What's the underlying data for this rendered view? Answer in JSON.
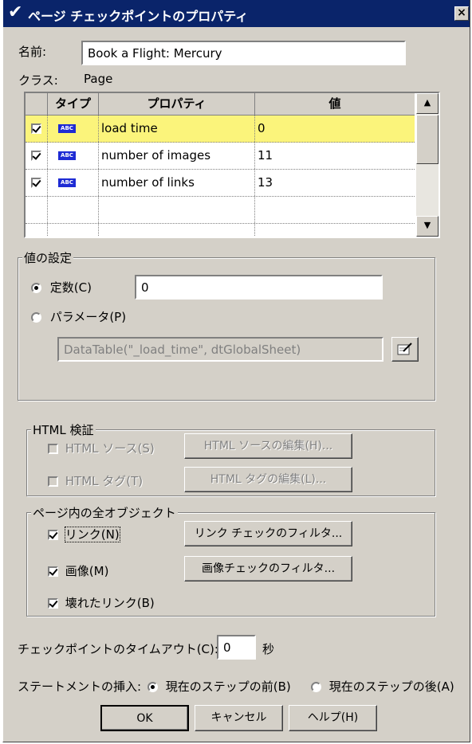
{
  "window": {
    "title": "ページ チェックポイントのプロパティ",
    "close": "×"
  },
  "name_label": "名前:",
  "name_value": "Book a Flight: Mercury",
  "class_label": "クラス:",
  "class_value": "Page",
  "table": {
    "headers": [
      "タイプ",
      "プロパティ",
      "値"
    ],
    "type_icon": "ABC",
    "rows": [
      {
        "checked": true,
        "property": "load time",
        "value": "0"
      },
      {
        "checked": true,
        "property": "number of images",
        "value": "11"
      },
      {
        "checked": true,
        "property": "number of links",
        "value": "13"
      }
    ]
  },
  "value_settings": {
    "label": "値の設定",
    "constant_label": "定数(C)",
    "constant_value": "0",
    "parameter_label": "パラメータ(P)",
    "parameter_value": "DataTable(\"_load_time\", dtGlobalSheet)"
  },
  "html_verify": {
    "label": "HTML 検証",
    "html_source": "HTML ソース(S)",
    "html_source_edit": "HTML ソースの編集(H)...",
    "html_tag": "HTML タグ(T)",
    "html_tag_edit": "HTML タグの編集(L)..."
  },
  "all_objects": {
    "label": "ページ内の全オブジェクト",
    "links": "リンク(N)",
    "link_filter": "リンク チェックのフィルタ...",
    "images": "画像(M)",
    "image_filter": "画像チェックのフィルタ...",
    "broken_links": "壊れたリンク(B)"
  },
  "timeout": {
    "label": "チェックポイントのタイムアウト(C):",
    "value": "0",
    "unit": "秒"
  },
  "insert": {
    "label": "ステートメントの挿入:",
    "before": "現在のステップの前(B)",
    "after": "現在のステップの後(A)"
  },
  "buttons": {
    "ok": "OK",
    "cancel": "キャンセル",
    "help": "ヘルプ(H)"
  },
  "colors": {
    "titlebar": "#0a246a",
    "dialog": "#d4d0c8",
    "selected_row": "#fbf47b",
    "abc_icon": "#1e2bd4"
  }
}
